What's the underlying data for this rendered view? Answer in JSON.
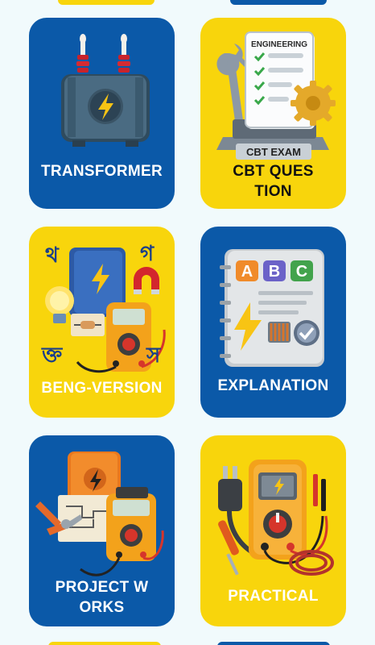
{
  "colors": {
    "background": "#f1fafc",
    "card_blue": "#0b59a8",
    "card_yellow": "#f8d50c"
  },
  "cards": [
    {
      "label": "TRANSFORMER",
      "illustration": "transformer-icon",
      "theme": "blue"
    },
    {
      "label": "CBT QUESTION",
      "illustration": "cbt-exam-icon",
      "theme": "yellow",
      "badge_top": "ENGINEERING",
      "badge_bottom": "CBT EXAM"
    },
    {
      "label": "BENG-VERSION",
      "illustration": "bengali-book-multimeter-icon",
      "theme": "yellow",
      "glyphs": [
        "থ",
        "গ",
        "ক্ত",
        "স"
      ]
    },
    {
      "label": "EXPLANATION",
      "illustration": "abc-notebook-icon",
      "theme": "blue",
      "letters": [
        "A",
        "B",
        "C"
      ]
    },
    {
      "label": "PROJECT WORKS",
      "illustration": "project-tools-icon",
      "theme": "blue"
    },
    {
      "label": "PRACTICAL",
      "illustration": "multimeter-plug-icon",
      "theme": "yellow"
    }
  ]
}
